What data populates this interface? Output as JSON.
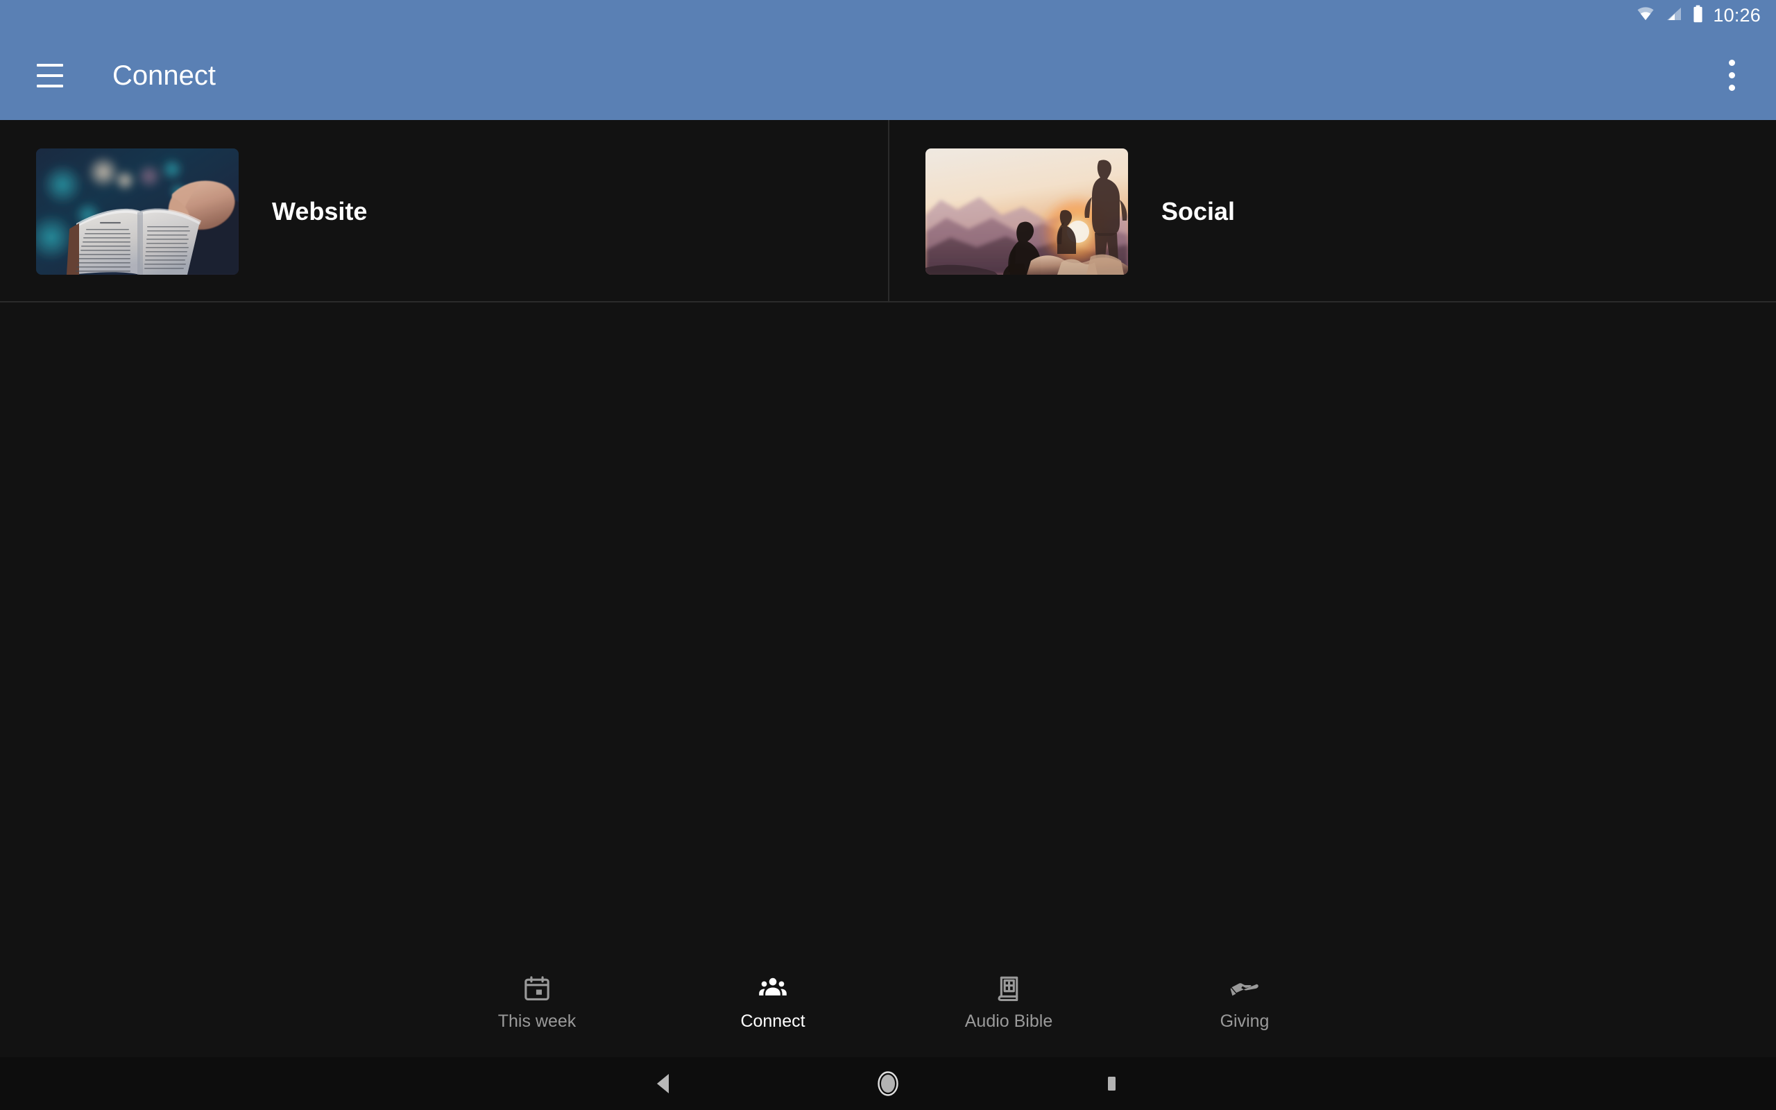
{
  "status_bar": {
    "time": "10:26",
    "icons": [
      "wifi-icon",
      "cellular-signal-icon",
      "battery-icon"
    ]
  },
  "toolbar": {
    "title": "Connect",
    "menu_icon": "hamburger-menu-icon",
    "overflow_icon": "overflow-menu-icon"
  },
  "theme": {
    "appbar_color": "#5a80b4",
    "background_color": "#121212",
    "divider_color": "#2b2b2b",
    "active_text_color": "#ffffff",
    "inactive_text_color": "#9a9a9a"
  },
  "main": {
    "cells": [
      {
        "label": "Website",
        "thumbnail": "open-bible-in-hands-photo"
      },
      {
        "label": "Social",
        "thumbnail": "people-watching-mountain-sunset-photo"
      }
    ]
  },
  "bottom_nav": {
    "items": [
      {
        "label": "This week",
        "icon": "calendar-icon",
        "active": false
      },
      {
        "label": "Connect",
        "icon": "groups-icon",
        "active": true
      },
      {
        "label": "Audio Bible",
        "icon": "bible-book-icon",
        "active": false
      },
      {
        "label": "Giving",
        "icon": "open-hand-giving-icon",
        "active": false
      }
    ]
  },
  "system_nav": {
    "back_label": "Back",
    "home_label": "Home",
    "recents_label": "Recents"
  }
}
